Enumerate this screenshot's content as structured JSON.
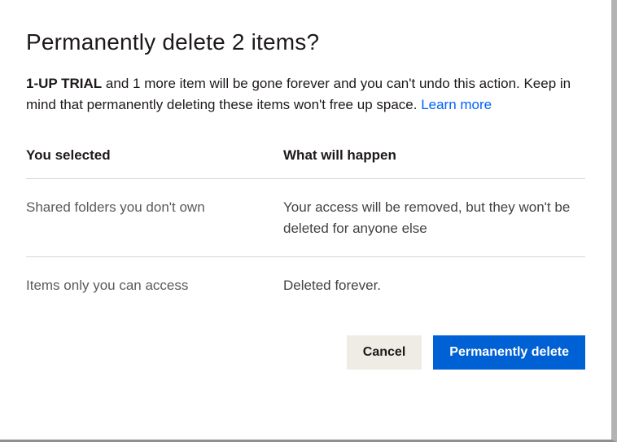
{
  "dialog": {
    "title": "Permanently delete 2 items?",
    "body_bold": "1-UP TRIAL",
    "body_rest": " and 1 more item will be gone forever and you can't undo this action. Keep in mind that permanently deleting these items won't free up space. ",
    "learn_more": "Learn more"
  },
  "table": {
    "selected_header": "You selected",
    "outcome_header": "What will happen",
    "rows": [
      {
        "selected": "Shared folders you don't own",
        "outcome": "Your access will be removed, but they won't be deleted for anyone else"
      },
      {
        "selected": "Items only you can access",
        "outcome": "Deleted forever."
      }
    ]
  },
  "actions": {
    "cancel": "Cancel",
    "confirm": "Permanently delete"
  }
}
